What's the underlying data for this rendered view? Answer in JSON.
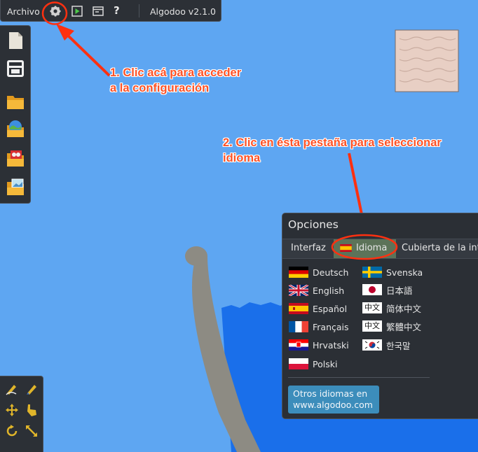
{
  "toolbar": {
    "menu_label": "Archivo",
    "version": "Algodoo v2.1.0",
    "icons": [
      "gear-icon",
      "play-icon",
      "window-icon",
      "help-icon"
    ],
    "help_glyph": "?"
  },
  "left_toolbar": {
    "icons": [
      "new-scene-icon",
      "save-icon",
      "open-folder-icon",
      "open-scene-folder-icon",
      "open-phunlet-folder-icon",
      "image-folder-icon"
    ]
  },
  "tools": {
    "icons": [
      "sketch-icon",
      "brush-icon",
      "move-icon",
      "drag-icon",
      "rotate-icon",
      "scale-icon"
    ]
  },
  "annotations": {
    "step1": [
      "1. Clic acá para acceder",
      "a la configuración"
    ],
    "step2": [
      "2. Clic en ésta pestaña para seleccionar",
      "idioma"
    ],
    "color": "#ff5227"
  },
  "options": {
    "title": "Opciones",
    "tabs": [
      "Interfaz",
      "Idioma",
      "Cubierta de la int"
    ],
    "active_tab": "Idioma",
    "languages_left": [
      "Deutsch",
      "English",
      "Español",
      "Français",
      "Hrvatski",
      "Polski"
    ],
    "languages_right": [
      "Svenska",
      "日本語",
      "简体中文",
      "繁體中文",
      "한국말"
    ],
    "chinese_badge": "中文",
    "more_button": [
      "Otros idiomas en",
      "www.algodoo.com"
    ]
  },
  "colors": {
    "sky": "#5ea6f2",
    "water": "#1a6fea",
    "panel": "#2c3036",
    "active_tab": "#5c7359",
    "button": "#3c8dbb"
  }
}
